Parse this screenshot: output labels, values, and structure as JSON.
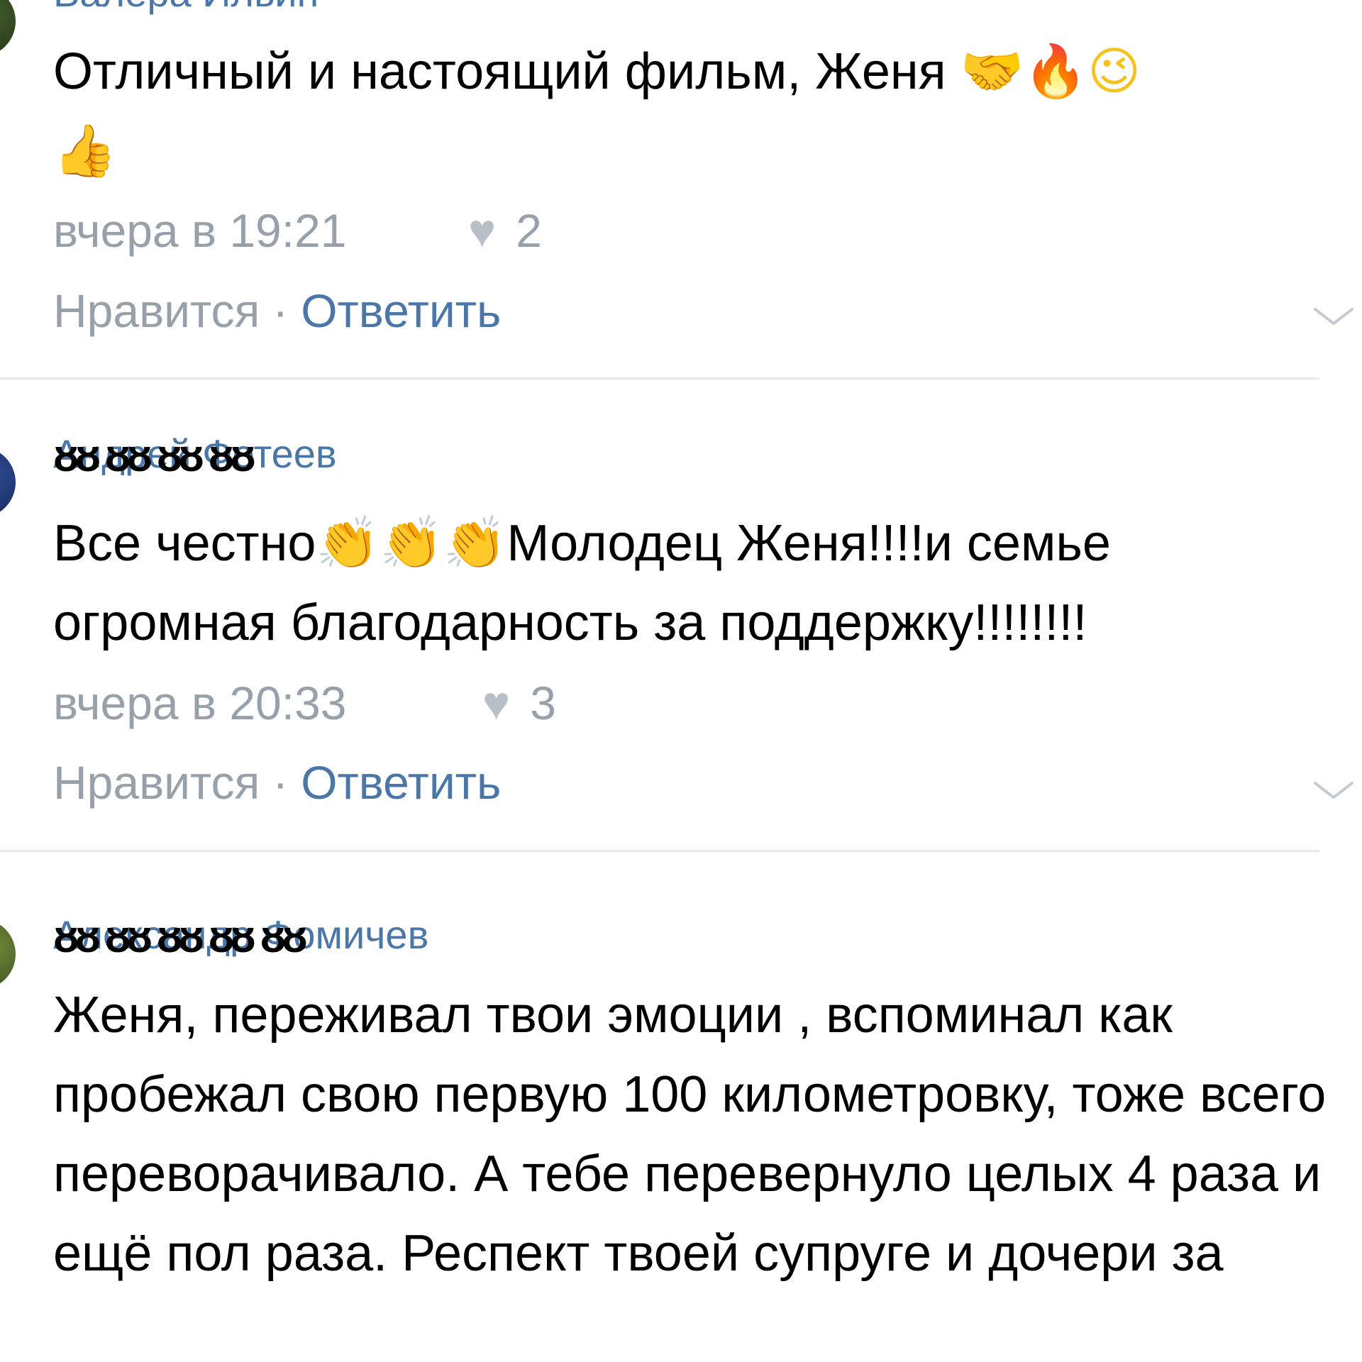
{
  "comments": [
    {
      "author": "Валера Ильин",
      "author_mask": "ᴕᴕ ᴕᴕ",
      "text": "Отличный и настоящий фильм, Женя ",
      "emojis": [
        "🤝",
        "🔥",
        "😉",
        "👍"
      ],
      "timestamp": "вчера в 19:21",
      "likes": "2",
      "like_label": "Нравится",
      "separator": "·",
      "reply_label": "Ответить"
    },
    {
      "author": "Андрей Фотеев",
      "author_mask": "ᴕᴕ ᴕᴕ ᴕᴕ ᴕᴕ",
      "text_before": "Все честно",
      "emojis": [
        "👏",
        "👏",
        "👏"
      ],
      "text_after": "Молодец Женя!!!!и семье огромная благодарность за поддержку!!!!!!!!",
      "timestamp": "вчера в 20:33",
      "likes": "3",
      "like_label": "Нравится",
      "separator": "·",
      "reply_label": "Ответить"
    },
    {
      "author": "Александр Фомичев",
      "author_mask": "ᴕᴕ ᴕᴕ ᴕᴕ ᴕᴕ ᴕᴕ",
      "text": "Женя, переживал твои эмоции , вспоминал как пробежал свою первую 100 километровку, тоже всего переворачивало. А тебе перевернуло целых 4 раза и ещё пол раза. Респект твоей супруге и дочери за"
    }
  ],
  "colors": {
    "link": "#4a76a8",
    "secondary_text": "#98a0aa",
    "divider": "#e6e9ee"
  },
  "icons": {
    "heart": "heart-icon",
    "chevron": "chevron-down-icon"
  }
}
